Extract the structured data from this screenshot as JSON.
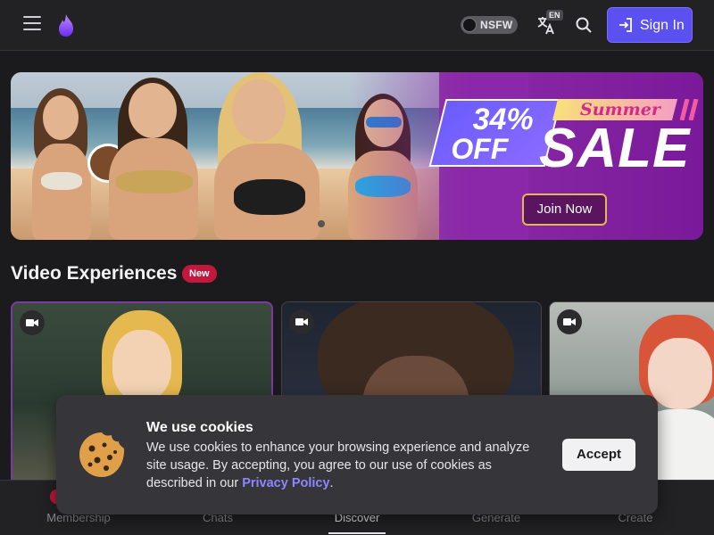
{
  "header": {
    "nsfw_label": "NSFW",
    "lang_badge": "EN",
    "signin_label": "Sign In",
    "icons": [
      "menu-icon",
      "flame-logo-icon",
      "translate-icon",
      "search-icon",
      "login-icon"
    ]
  },
  "banner": {
    "discount": "34%",
    "off": "OFF",
    "summer": "Summer",
    "sale": "SALE",
    "cta": "Join Now"
  },
  "section": {
    "title": "Video Experiences",
    "badge": "New"
  },
  "cards": [
    {
      "icon": "video-camera-icon"
    },
    {
      "icon": "video-camera-icon"
    },
    {
      "icon": "video-camera-icon"
    }
  ],
  "bottom_nav": {
    "items": [
      "Membership",
      "Chats",
      "Discover",
      "Generate",
      "Create"
    ],
    "active": "Discover"
  },
  "cookie": {
    "title": "We use cookies",
    "text": "We use cookies to enhance your browsing experience and analyze site usage. By accepting, you agree to our use of cookies as described in our",
    "link": "Privacy Policy",
    "period": ".",
    "accept": "Accept"
  },
  "colors": {
    "accent": "#5b50f0",
    "badge_red": "#c2183e",
    "link": "#8c86ff"
  }
}
